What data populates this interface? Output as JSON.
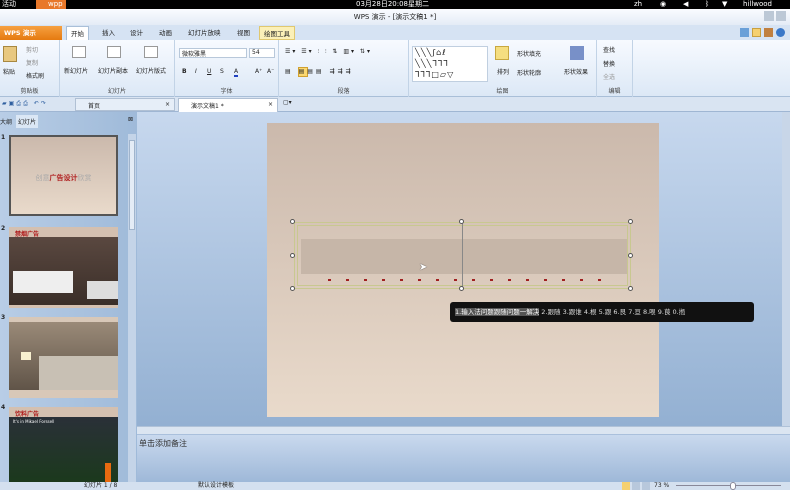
{
  "system_bar": {
    "activities": "活动",
    "app": "wpp",
    "datetime": "03月28日20:08星期二",
    "lang": "zh",
    "user": "hillwood"
  },
  "window": {
    "title": "WPS 演示 - [演示文稿1 *]"
  },
  "menu": {
    "app_button": "WPS 演示",
    "tabs": [
      "开始",
      "插入",
      "设计",
      "动画",
      "幻灯片放映",
      "视图",
      "绘图工具"
    ],
    "active_tab": "开始"
  },
  "ribbon": {
    "clipboard": {
      "label": "剪贴板",
      "paste": "粘贴",
      "cut": "剪切",
      "copy": "复制",
      "format_painter": "格式刷"
    },
    "slides": {
      "label": "幻灯片",
      "new": "新幻灯片",
      "duplicate": "幻灯片副本",
      "layout": "幻灯片版式"
    },
    "font": {
      "label": "字体",
      "font_name": "微软雅黑",
      "font_size": "54",
      "bold": "B",
      "italic": "I",
      "underline": "U",
      "shadow": "S",
      "color": "A",
      "grow": "A⁺",
      "shrink": "A⁻"
    },
    "paragraph": {
      "label": "段落"
    },
    "drawing": {
      "label": "绘图",
      "arrange": "排列",
      "shape_fill": "形状填充",
      "shape_outline": "形状轮廓",
      "shape_effects": "形状效果"
    },
    "editing": {
      "label": "编辑",
      "find": "查找",
      "replace": "替换",
      "select_all": "全选"
    }
  },
  "doc_tabs": [
    {
      "label": "首页"
    },
    {
      "label": "演示文稿1 *"
    }
  ],
  "left_panel": {
    "tabs": [
      "大纲",
      "幻灯片"
    ],
    "active": "幻灯片",
    "slides": [
      {
        "num": "1",
        "title_pre": "创意",
        "title_main": "广告设计",
        "title_post": "欣赏"
      },
      {
        "num": "2",
        "title": "禁烟广告"
      },
      {
        "num": "3",
        "title": ""
      },
      {
        "num": "4",
        "title": "饮料广告",
        "subtitle": "It's in Mikael Forssell"
      }
    ]
  },
  "ime": {
    "candidates": [
      "1.输入法问题跟随问题一解决",
      "2.跟随",
      "3.跟谁",
      "4.根",
      "5.跟",
      "6.艮",
      "7.亘",
      "8.哏",
      "9.茛",
      "0.揯"
    ]
  },
  "notes": {
    "placeholder": "单击添加备注"
  },
  "status": {
    "slide_counter": "幻灯片 1 / 8",
    "template": "默认设计模板",
    "zoom": "73 %",
    "zoom_percent": 73
  }
}
